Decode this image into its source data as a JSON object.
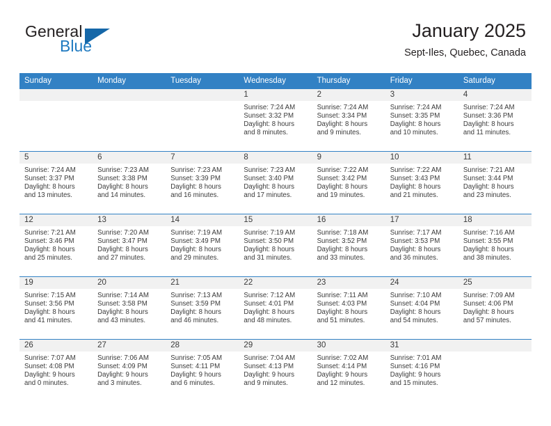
{
  "brand": {
    "name_line1": "General",
    "name_line2": "Blue",
    "accent_color": "#1567a8",
    "text_color": "#231f20"
  },
  "header": {
    "title": "January 2025",
    "location": "Sept-Iles, Quebec, Canada"
  },
  "theme": {
    "header_band": "#3281c4",
    "daynum_band": "#f1f1f1",
    "body_text": "#3a3a3a"
  },
  "weekdays": [
    "Sunday",
    "Monday",
    "Tuesday",
    "Wednesday",
    "Thursday",
    "Friday",
    "Saturday"
  ],
  "weeks": [
    [
      {
        "day": "",
        "sunrise": "",
        "sunset": "",
        "daylight1": "",
        "daylight2": ""
      },
      {
        "day": "",
        "sunrise": "",
        "sunset": "",
        "daylight1": "",
        "daylight2": ""
      },
      {
        "day": "",
        "sunrise": "",
        "sunset": "",
        "daylight1": "",
        "daylight2": ""
      },
      {
        "day": "1",
        "sunrise": "Sunrise: 7:24 AM",
        "sunset": "Sunset: 3:32 PM",
        "daylight1": "Daylight: 8 hours",
        "daylight2": "and 8 minutes."
      },
      {
        "day": "2",
        "sunrise": "Sunrise: 7:24 AM",
        "sunset": "Sunset: 3:34 PM",
        "daylight1": "Daylight: 8 hours",
        "daylight2": "and 9 minutes."
      },
      {
        "day": "3",
        "sunrise": "Sunrise: 7:24 AM",
        "sunset": "Sunset: 3:35 PM",
        "daylight1": "Daylight: 8 hours",
        "daylight2": "and 10 minutes."
      },
      {
        "day": "4",
        "sunrise": "Sunrise: 7:24 AM",
        "sunset": "Sunset: 3:36 PM",
        "daylight1": "Daylight: 8 hours",
        "daylight2": "and 11 minutes."
      }
    ],
    [
      {
        "day": "5",
        "sunrise": "Sunrise: 7:24 AM",
        "sunset": "Sunset: 3:37 PM",
        "daylight1": "Daylight: 8 hours",
        "daylight2": "and 13 minutes."
      },
      {
        "day": "6",
        "sunrise": "Sunrise: 7:23 AM",
        "sunset": "Sunset: 3:38 PM",
        "daylight1": "Daylight: 8 hours",
        "daylight2": "and 14 minutes."
      },
      {
        "day": "7",
        "sunrise": "Sunrise: 7:23 AM",
        "sunset": "Sunset: 3:39 PM",
        "daylight1": "Daylight: 8 hours",
        "daylight2": "and 16 minutes."
      },
      {
        "day": "8",
        "sunrise": "Sunrise: 7:23 AM",
        "sunset": "Sunset: 3:40 PM",
        "daylight1": "Daylight: 8 hours",
        "daylight2": "and 17 minutes."
      },
      {
        "day": "9",
        "sunrise": "Sunrise: 7:22 AM",
        "sunset": "Sunset: 3:42 PM",
        "daylight1": "Daylight: 8 hours",
        "daylight2": "and 19 minutes."
      },
      {
        "day": "10",
        "sunrise": "Sunrise: 7:22 AM",
        "sunset": "Sunset: 3:43 PM",
        "daylight1": "Daylight: 8 hours",
        "daylight2": "and 21 minutes."
      },
      {
        "day": "11",
        "sunrise": "Sunrise: 7:21 AM",
        "sunset": "Sunset: 3:44 PM",
        "daylight1": "Daylight: 8 hours",
        "daylight2": "and 23 minutes."
      }
    ],
    [
      {
        "day": "12",
        "sunrise": "Sunrise: 7:21 AM",
        "sunset": "Sunset: 3:46 PM",
        "daylight1": "Daylight: 8 hours",
        "daylight2": "and 25 minutes."
      },
      {
        "day": "13",
        "sunrise": "Sunrise: 7:20 AM",
        "sunset": "Sunset: 3:47 PM",
        "daylight1": "Daylight: 8 hours",
        "daylight2": "and 27 minutes."
      },
      {
        "day": "14",
        "sunrise": "Sunrise: 7:19 AM",
        "sunset": "Sunset: 3:49 PM",
        "daylight1": "Daylight: 8 hours",
        "daylight2": "and 29 minutes."
      },
      {
        "day": "15",
        "sunrise": "Sunrise: 7:19 AM",
        "sunset": "Sunset: 3:50 PM",
        "daylight1": "Daylight: 8 hours",
        "daylight2": "and 31 minutes."
      },
      {
        "day": "16",
        "sunrise": "Sunrise: 7:18 AM",
        "sunset": "Sunset: 3:52 PM",
        "daylight1": "Daylight: 8 hours",
        "daylight2": "and 33 minutes."
      },
      {
        "day": "17",
        "sunrise": "Sunrise: 7:17 AM",
        "sunset": "Sunset: 3:53 PM",
        "daylight1": "Daylight: 8 hours",
        "daylight2": "and 36 minutes."
      },
      {
        "day": "18",
        "sunrise": "Sunrise: 7:16 AM",
        "sunset": "Sunset: 3:55 PM",
        "daylight1": "Daylight: 8 hours",
        "daylight2": "and 38 minutes."
      }
    ],
    [
      {
        "day": "19",
        "sunrise": "Sunrise: 7:15 AM",
        "sunset": "Sunset: 3:56 PM",
        "daylight1": "Daylight: 8 hours",
        "daylight2": "and 41 minutes."
      },
      {
        "day": "20",
        "sunrise": "Sunrise: 7:14 AM",
        "sunset": "Sunset: 3:58 PM",
        "daylight1": "Daylight: 8 hours",
        "daylight2": "and 43 minutes."
      },
      {
        "day": "21",
        "sunrise": "Sunrise: 7:13 AM",
        "sunset": "Sunset: 3:59 PM",
        "daylight1": "Daylight: 8 hours",
        "daylight2": "and 46 minutes."
      },
      {
        "day": "22",
        "sunrise": "Sunrise: 7:12 AM",
        "sunset": "Sunset: 4:01 PM",
        "daylight1": "Daylight: 8 hours",
        "daylight2": "and 48 minutes."
      },
      {
        "day": "23",
        "sunrise": "Sunrise: 7:11 AM",
        "sunset": "Sunset: 4:03 PM",
        "daylight1": "Daylight: 8 hours",
        "daylight2": "and 51 minutes."
      },
      {
        "day": "24",
        "sunrise": "Sunrise: 7:10 AM",
        "sunset": "Sunset: 4:04 PM",
        "daylight1": "Daylight: 8 hours",
        "daylight2": "and 54 minutes."
      },
      {
        "day": "25",
        "sunrise": "Sunrise: 7:09 AM",
        "sunset": "Sunset: 4:06 PM",
        "daylight1": "Daylight: 8 hours",
        "daylight2": "and 57 minutes."
      }
    ],
    [
      {
        "day": "26",
        "sunrise": "Sunrise: 7:07 AM",
        "sunset": "Sunset: 4:08 PM",
        "daylight1": "Daylight: 9 hours",
        "daylight2": "and 0 minutes."
      },
      {
        "day": "27",
        "sunrise": "Sunrise: 7:06 AM",
        "sunset": "Sunset: 4:09 PM",
        "daylight1": "Daylight: 9 hours",
        "daylight2": "and 3 minutes."
      },
      {
        "day": "28",
        "sunrise": "Sunrise: 7:05 AM",
        "sunset": "Sunset: 4:11 PM",
        "daylight1": "Daylight: 9 hours",
        "daylight2": "and 6 minutes."
      },
      {
        "day": "29",
        "sunrise": "Sunrise: 7:04 AM",
        "sunset": "Sunset: 4:13 PM",
        "daylight1": "Daylight: 9 hours",
        "daylight2": "and 9 minutes."
      },
      {
        "day": "30",
        "sunrise": "Sunrise: 7:02 AM",
        "sunset": "Sunset: 4:14 PM",
        "daylight1": "Daylight: 9 hours",
        "daylight2": "and 12 minutes."
      },
      {
        "day": "31",
        "sunrise": "Sunrise: 7:01 AM",
        "sunset": "Sunset: 4:16 PM",
        "daylight1": "Daylight: 9 hours",
        "daylight2": "and 15 minutes."
      },
      {
        "day": "",
        "sunrise": "",
        "sunset": "",
        "daylight1": "",
        "daylight2": ""
      }
    ]
  ]
}
